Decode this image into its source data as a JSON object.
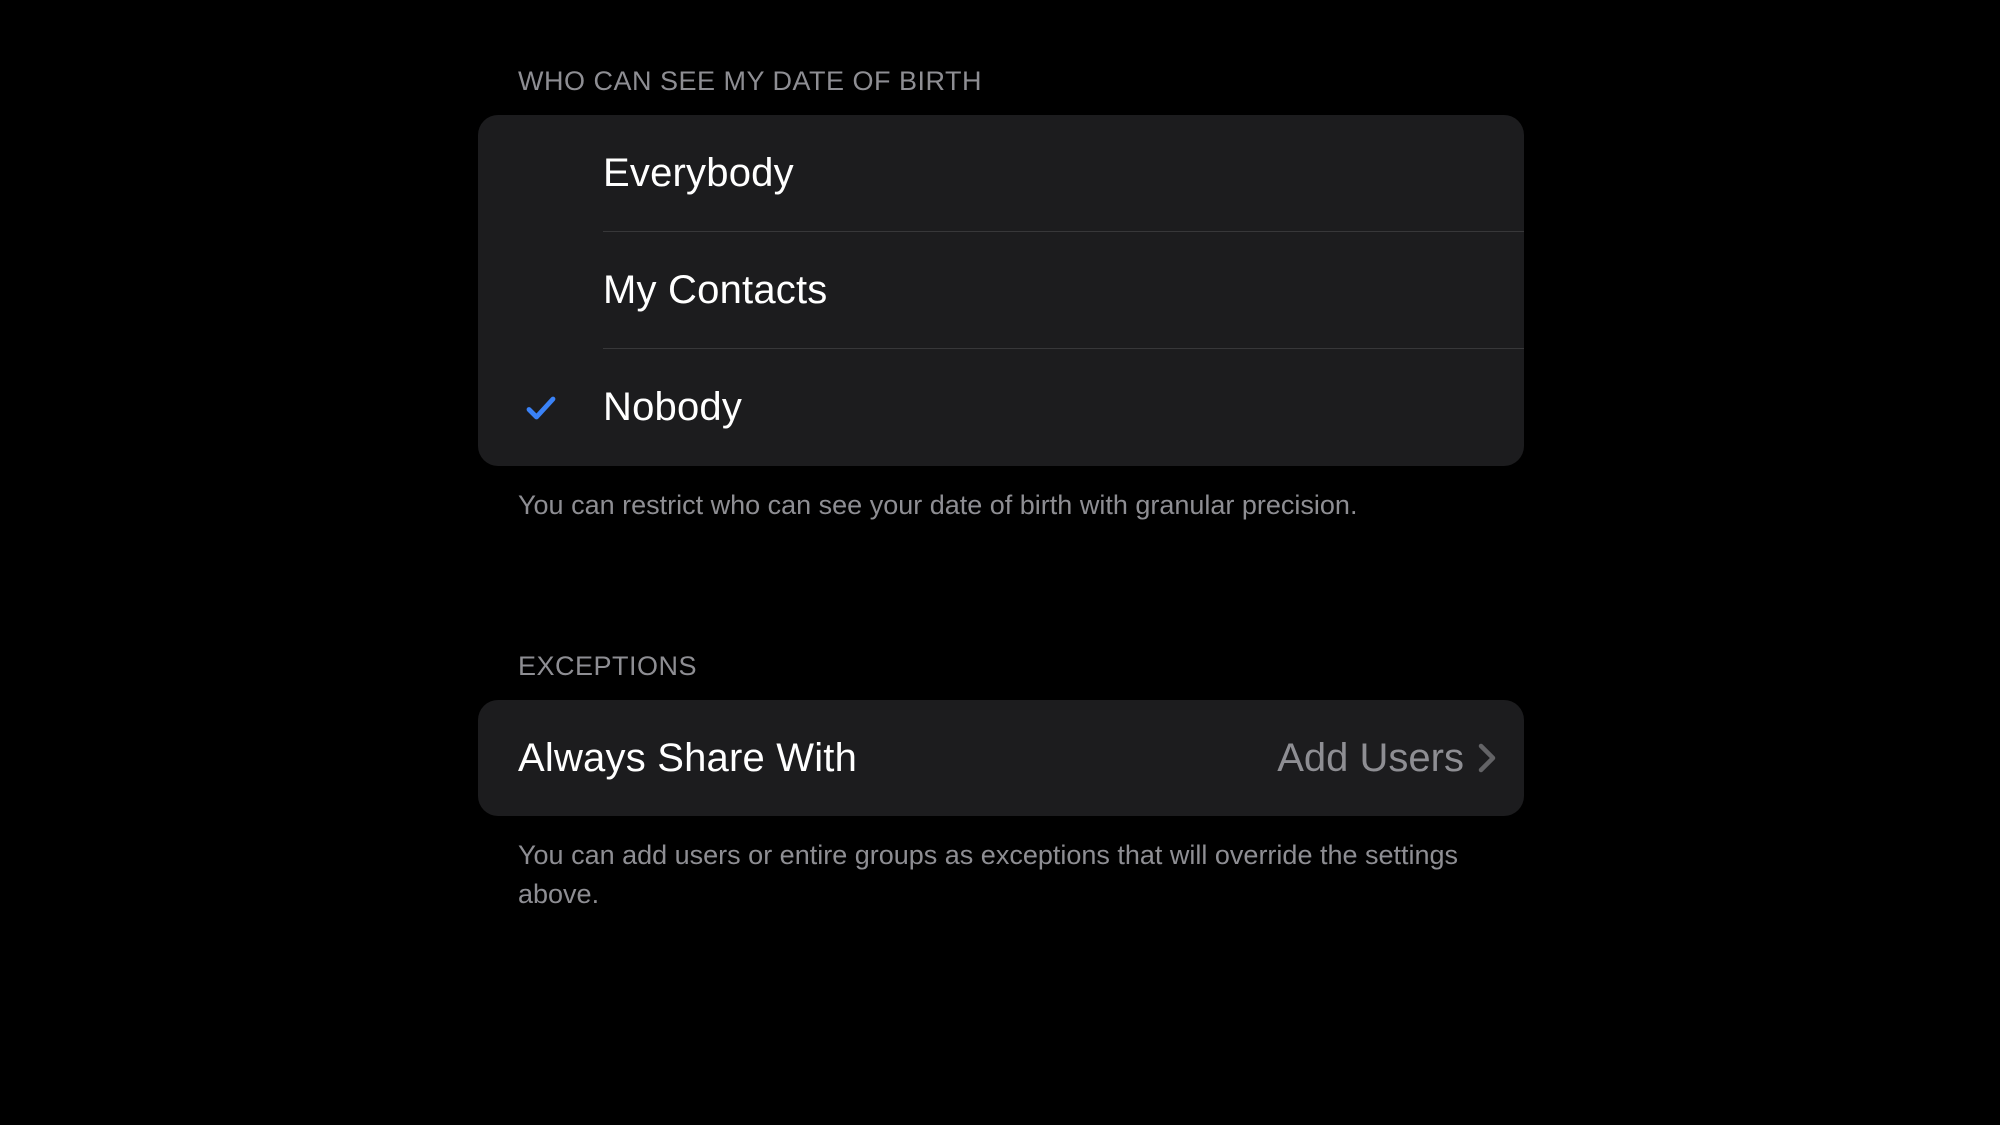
{
  "visibility": {
    "header": "WHO CAN SEE MY DATE OF BIRTH",
    "options": [
      {
        "label": "Everybody",
        "selected": false
      },
      {
        "label": "My Contacts",
        "selected": false
      },
      {
        "label": "Nobody",
        "selected": true
      }
    ],
    "footer": "You can restrict who can see your date of birth with granular precision."
  },
  "exceptions": {
    "header": "EXCEPTIONS",
    "row": {
      "label": "Always Share With",
      "value": "Add Users"
    },
    "footer": "You can add users or entire groups as exceptions that will override the settings above."
  },
  "colors": {
    "accent_blue": "#3a82f7",
    "chevron_gray": "#636366"
  }
}
